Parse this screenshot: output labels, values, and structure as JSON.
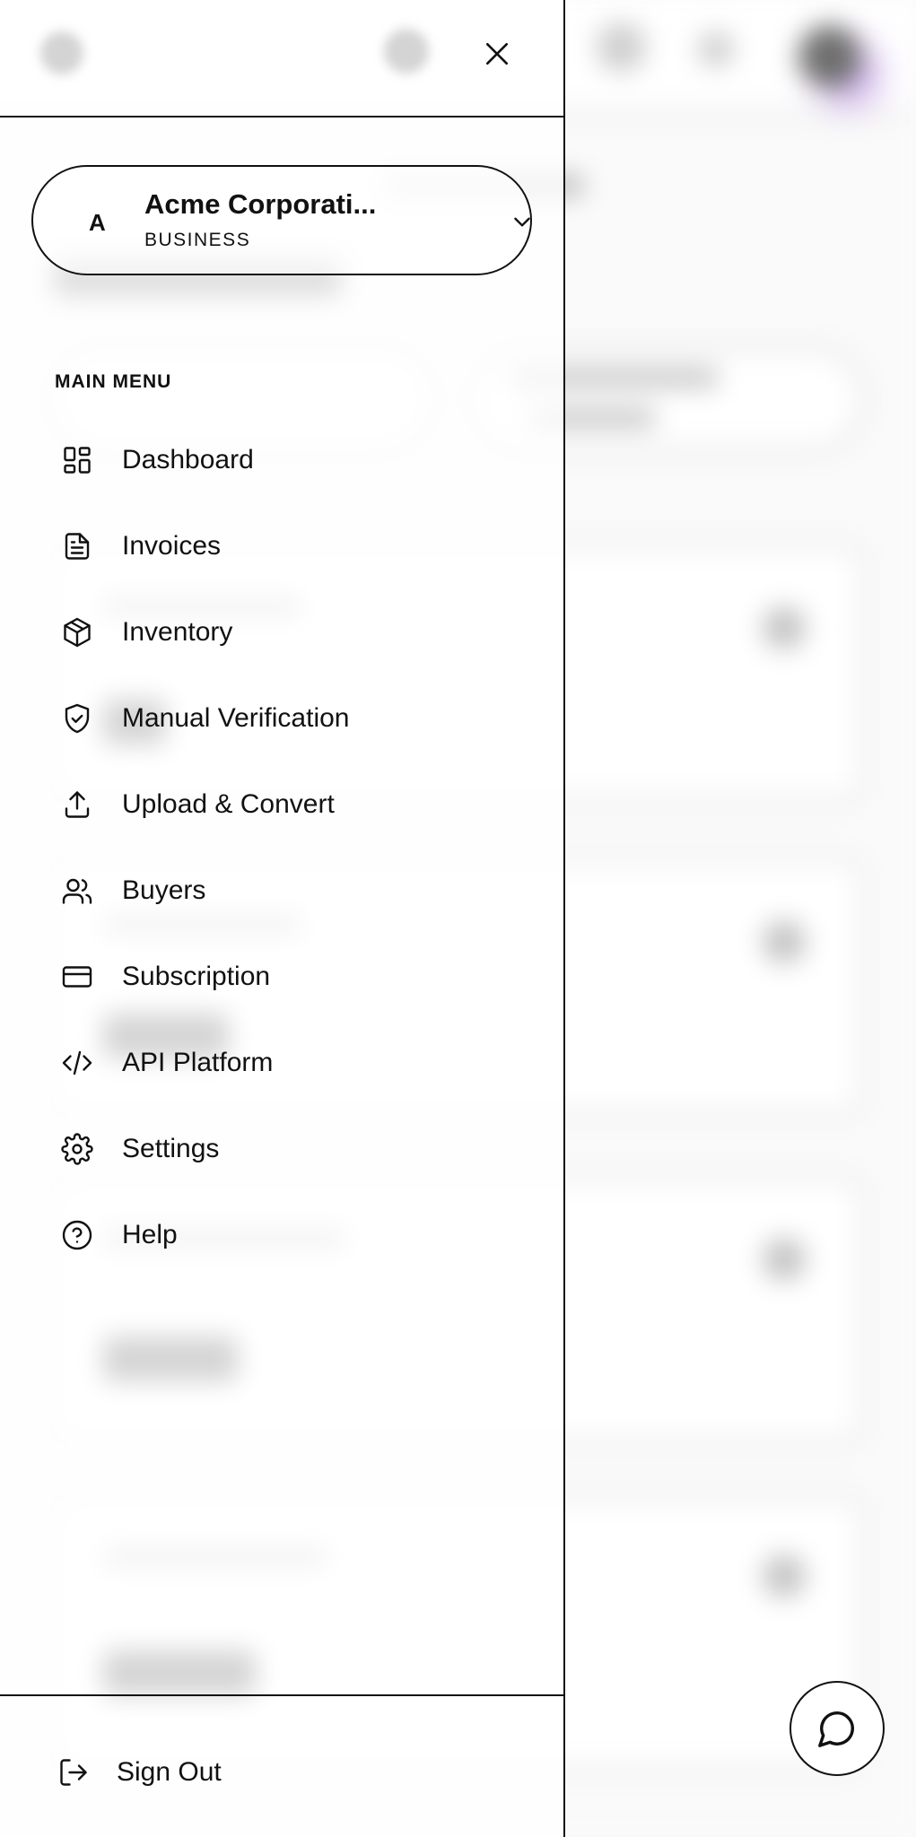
{
  "organization": {
    "avatar_letter": "A",
    "name": "Acme Corporati...",
    "type": "BUSINESS"
  },
  "menu": {
    "heading": "MAIN MENU",
    "items": [
      {
        "label": "Dashboard",
        "icon": "dashboard-grid-icon"
      },
      {
        "label": "Invoices",
        "icon": "document-icon"
      },
      {
        "label": "Inventory",
        "icon": "package-box-icon"
      },
      {
        "label": "Manual Verification",
        "icon": "shield-check-icon"
      },
      {
        "label": "Upload & Convert",
        "icon": "upload-icon"
      },
      {
        "label": "Buyers",
        "icon": "users-icon"
      },
      {
        "label": "Subscription",
        "icon": "credit-card-icon"
      },
      {
        "label": "API Platform",
        "icon": "code-icon"
      },
      {
        "label": "Settings",
        "icon": "gear-icon"
      },
      {
        "label": "Help",
        "icon": "help-circle-icon"
      }
    ]
  },
  "footer": {
    "sign_out_label": "Sign Out"
  }
}
